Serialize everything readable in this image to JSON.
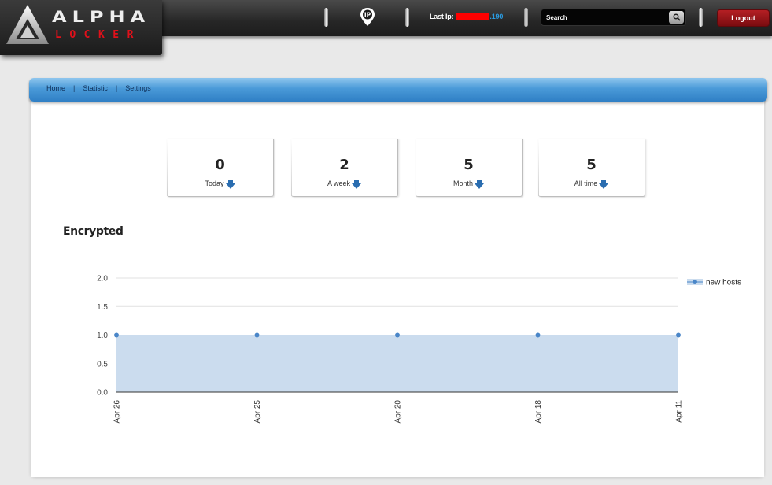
{
  "app": {
    "logo_word": "ALPHA",
    "logo_sub": "LOCKER"
  },
  "topbar": {
    "ip_icon_label": "IP",
    "last_ip_label": "Last Ip:",
    "last_ip_value": ".190",
    "search_placeholder": "Search",
    "logout_label": "Logout"
  },
  "nav": {
    "items": [
      {
        "label": "Home"
      },
      {
        "label": "Statistic"
      },
      {
        "label": "Settings"
      }
    ],
    "separator": "|"
  },
  "stats": [
    {
      "value": "0",
      "label": "Today"
    },
    {
      "value": "2",
      "label": "A week"
    },
    {
      "value": "5",
      "label": "Month"
    },
    {
      "value": "5",
      "label": "All time"
    }
  ],
  "section_title": "Encrypted",
  "colors": {
    "accent": "#2f7fc5",
    "logout": "#9e1519",
    "series_fill": "#cbdcee",
    "series_line": "#4a86c8",
    "redaction": "#ff0000"
  },
  "chart_data": {
    "type": "area",
    "categories": [
      "Apr 26",
      "Apr 25",
      "Apr 20",
      "Apr 18",
      "Apr 11"
    ],
    "series": [
      {
        "name": "new hosts",
        "values": [
          1,
          1,
          1,
          1,
          1
        ]
      }
    ],
    "y_ticks": [
      "0.0",
      "0.5",
      "1.0",
      "1.5",
      "2.0"
    ],
    "ylim": [
      0,
      2
    ],
    "grid": true,
    "legend_position": "right"
  }
}
